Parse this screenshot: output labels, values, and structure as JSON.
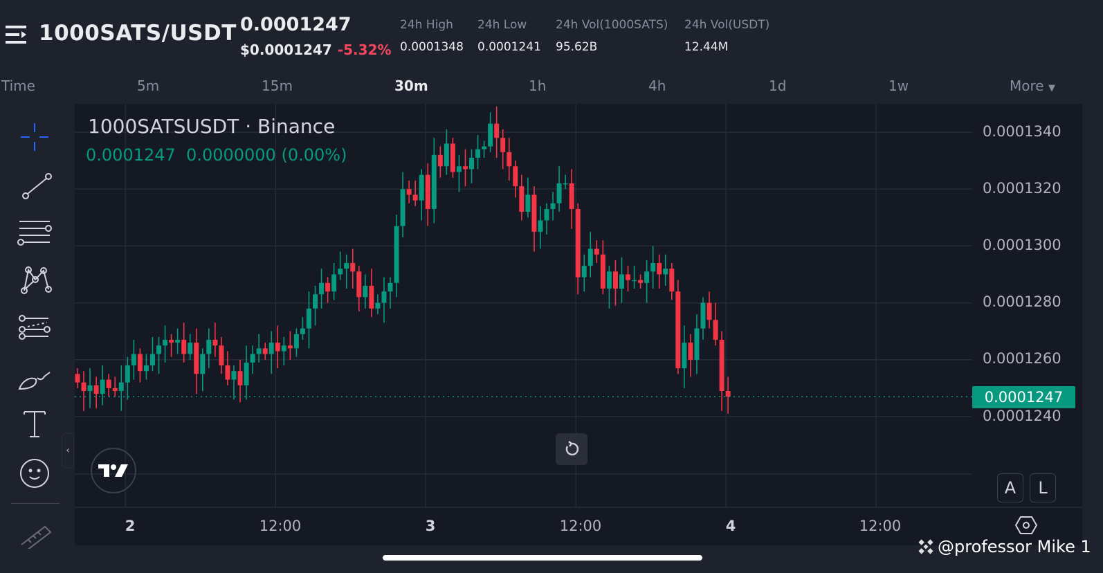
{
  "header": {
    "pair": "1000SATS/USDT",
    "last_price": "0.0001247",
    "usd_price": "$0.0001247",
    "change_pct": "-5.32%",
    "stats": [
      {
        "label": "24h High",
        "value": "0.0001348"
      },
      {
        "label": "24h Low",
        "value": "0.0001241"
      },
      {
        "label": "24h Vol(1000SATS)",
        "value": "95.62B"
      },
      {
        "label": "24h Vol(USDT)",
        "value": "12.44M"
      }
    ]
  },
  "timeframes": {
    "items": [
      "Time",
      "5m",
      "15m",
      "30m",
      "1h",
      "4h",
      "1d",
      "1w",
      "More"
    ],
    "active": "30m"
  },
  "legend": {
    "title": "1000SATSUSDT · Binance",
    "values": "0.0001247  0.0000000 (0.00%)"
  },
  "price_axis": {
    "current_price": "0.0001247"
  },
  "buttons": {
    "auto": "A",
    "log": "L"
  },
  "watermark": "@professor Mike 1",
  "colors": {
    "up": "#089981",
    "down": "#f23645",
    "background": "#151924"
  },
  "chart_data": {
    "type": "candlestick",
    "title": "1000SATSUSDT · Binance",
    "interval": "30m",
    "price_multiplier": 1e-07,
    "ylim": [
      1232,
      1347
    ],
    "yticks": [
      {
        "value": 1340,
        "label": "0.0001340"
      },
      {
        "value": 1320,
        "label": "0.0001320"
      },
      {
        "value": 1300,
        "label": "0.0001300"
      },
      {
        "value": 1280,
        "label": "0.0001280"
      },
      {
        "value": 1260,
        "label": "0.0001260"
      },
      {
        "value": 1240,
        "label": "0.0001240"
      }
    ],
    "xticks": [
      {
        "index": 8,
        "label": "2",
        "bold": true
      },
      {
        "index": 32,
        "label": "12:00",
        "bold": false
      },
      {
        "index": 56,
        "label": "3",
        "bold": true
      },
      {
        "index": 80,
        "label": "12:00",
        "bold": false
      },
      {
        "index": 104,
        "label": "4",
        "bold": true
      },
      {
        "index": 128,
        "label": "12:00",
        "bold": false
      }
    ],
    "first_open": 1255,
    "close": [
      1252,
      1249,
      1251,
      1248,
      1253,
      1250,
      1249,
      1252,
      1258,
      1262,
      1256,
      1258,
      1262,
      1265,
      1267,
      1266,
      1267,
      1262,
      1266,
      1255,
      1262,
      1267,
      1265,
      1258,
      1253,
      1256,
      1251,
      1259,
      1262,
      1264,
      1262,
      1266,
      1263,
      1265,
      1264,
      1269,
      1271,
      1278,
      1283,
      1287,
      1284,
      1290,
      1292,
      1294,
      1291,
      1282,
      1286,
      1278,
      1280,
      1284,
      1287,
      1307,
      1320,
      1318,
      1316,
      1325,
      1313,
      1332,
      1328,
      1336,
      1326,
      1328,
      1327,
      1331,
      1334,
      1335,
      1343,
      1338,
      1333,
      1328,
      1321,
      1312,
      1318,
      1305,
      1309,
      1313,
      1315,
      1322,
      1322,
      1313,
      1289,
      1293,
      1299,
      1297,
      1285,
      1291,
      1285,
      1290,
      1288,
      1288,
      1287,
      1291,
      1294,
      1290,
      1292,
      1284,
      1257,
      1266,
      1260,
      1271,
      1280,
      1274,
      1267,
      1249,
      1247
    ],
    "current": 1247
  }
}
